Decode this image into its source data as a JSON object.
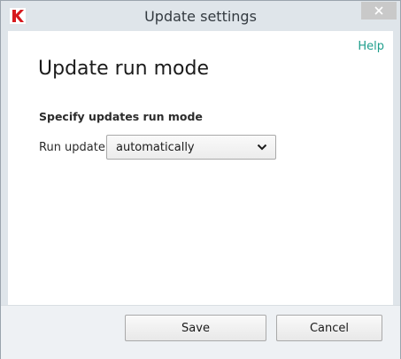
{
  "window": {
    "title": "Update settings",
    "logo_icon": "kaspersky-k-icon",
    "close_icon": "close-icon",
    "accent_color": "#1e9e8c",
    "close_button_color": "#c9c9c9"
  },
  "header": {
    "help_label": "Help"
  },
  "main": {
    "page_title": "Update run mode",
    "section_title": "Specify updates run mode",
    "run_update_label": "Run update",
    "run_update_selected": "automatically",
    "dropdown_icon": "chevron-down-icon"
  },
  "footer": {
    "save_label": "Save",
    "cancel_label": "Cancel"
  }
}
